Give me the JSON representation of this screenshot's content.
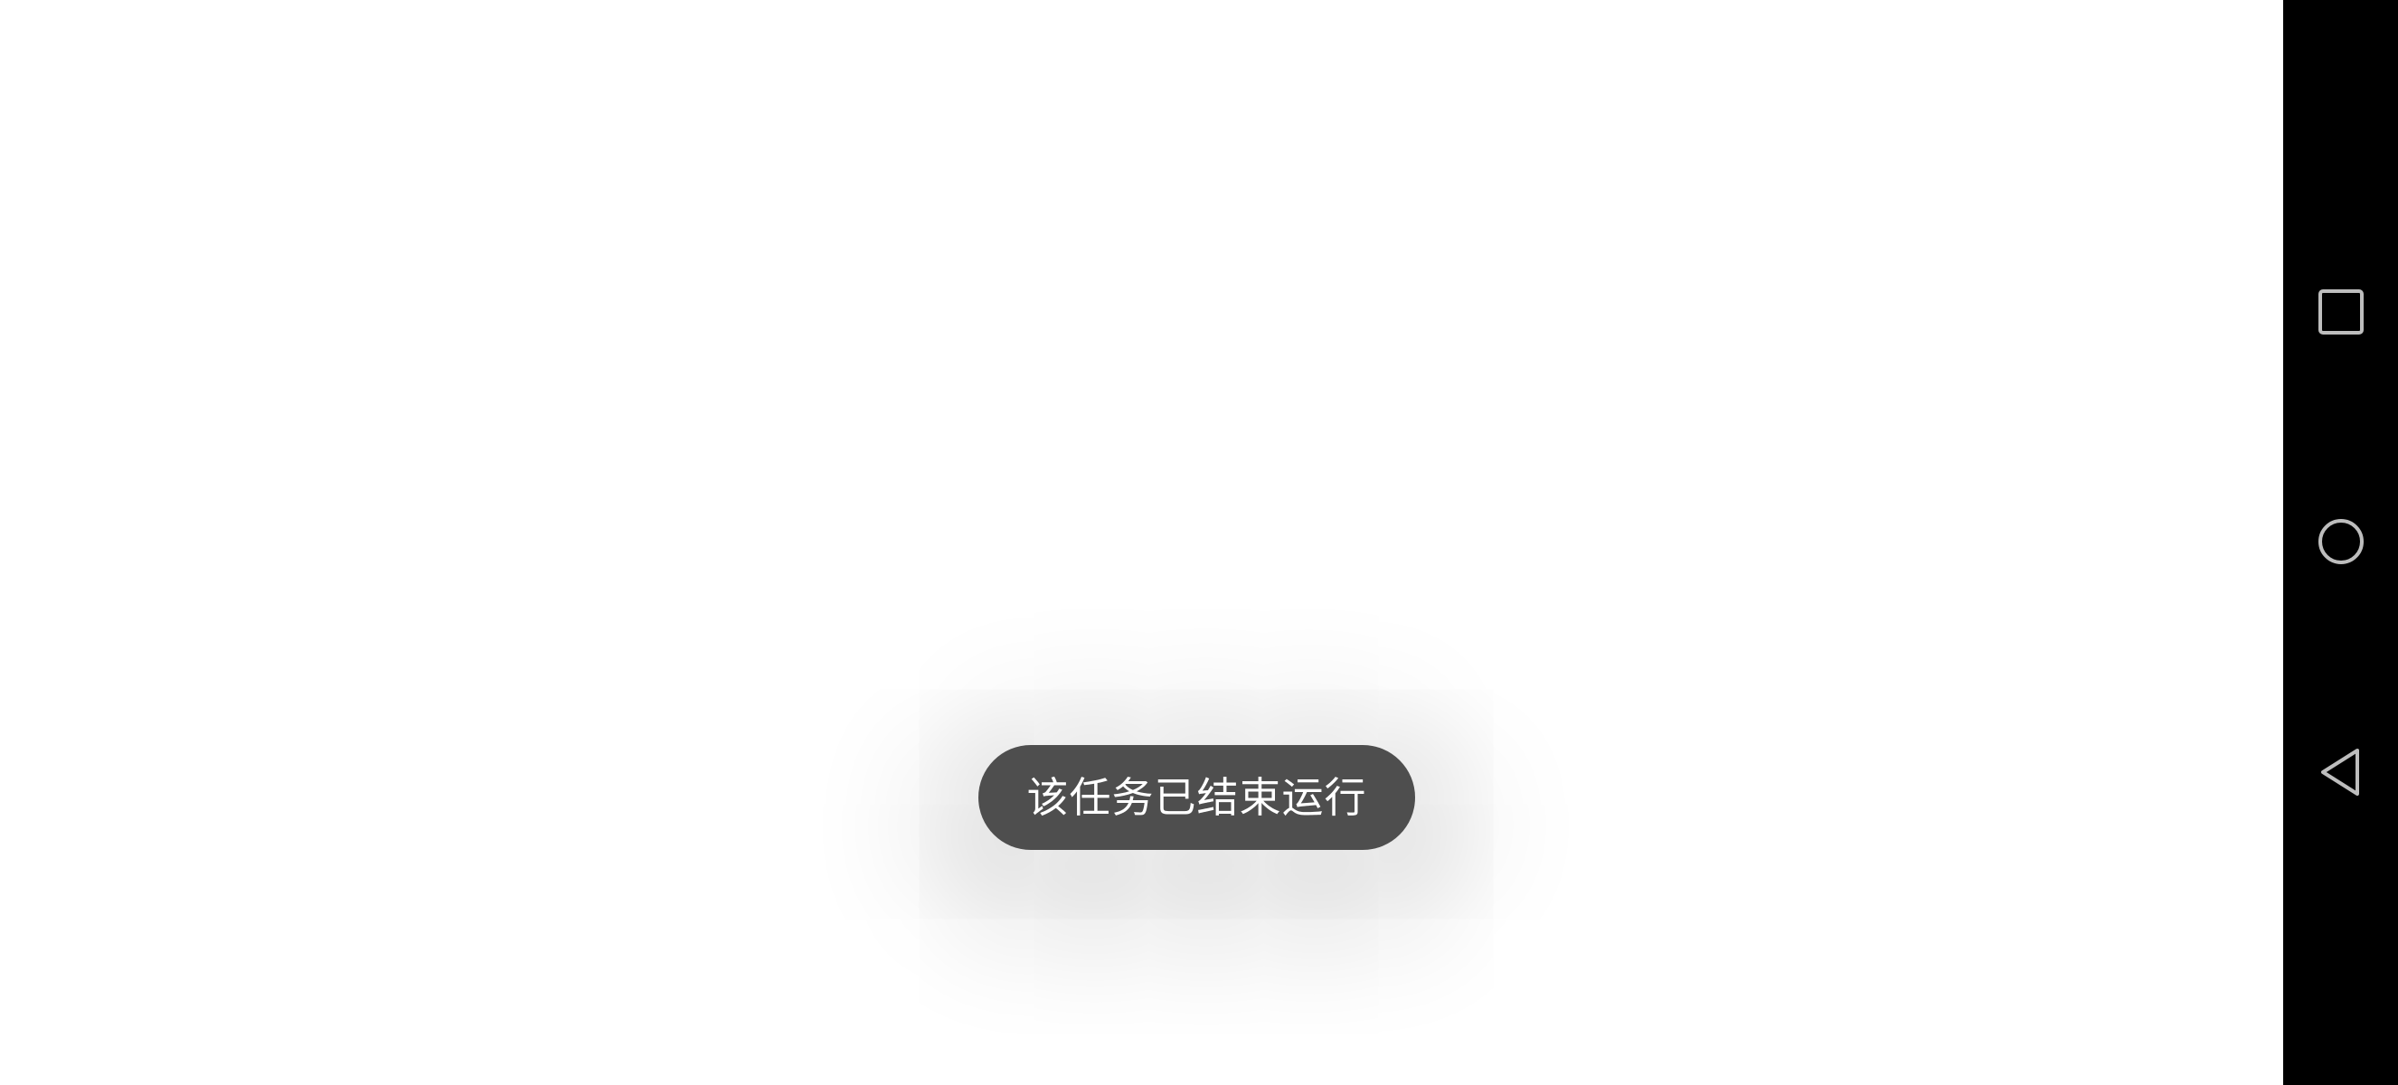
{
  "toast": {
    "message": "该任务已结束运行",
    "background_color": "#4e4e4e",
    "text_color": "#ffffff"
  },
  "navigation_bar": {
    "background_color": "#000000",
    "icon_color": "#bdbdbd",
    "buttons": [
      {
        "name": "recents",
        "icon": "square-icon"
      },
      {
        "name": "home",
        "icon": "circle-icon"
      },
      {
        "name": "back",
        "icon": "triangle-back-icon"
      }
    ]
  }
}
